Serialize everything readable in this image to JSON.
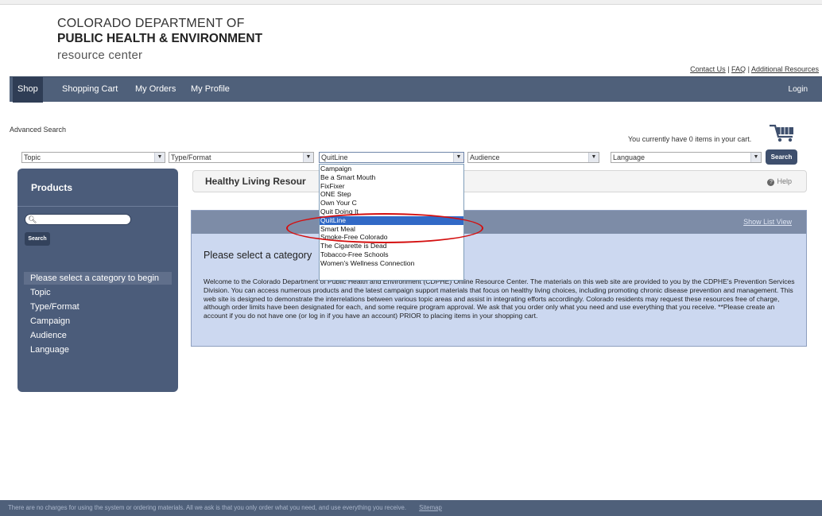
{
  "brand": {
    "line1": "COLORADO DEPARTMENT OF",
    "line2": "PUBLIC HEALTH & ENVIRONMENT",
    "line3": "resource center"
  },
  "top_links": {
    "contact": "Contact Us",
    "faq": "FAQ",
    "additional": "Additional Resources",
    "separator": "|"
  },
  "nav": {
    "shop": "Shop",
    "cart": "Shopping Cart",
    "orders": "My Orders",
    "profile": "My Profile",
    "login": "Login"
  },
  "advanced_search": "Advanced Search",
  "cart_message": "You currently have 0 items in your cart.",
  "filters": {
    "topic": "Topic",
    "type_format": "Type/Format",
    "campaign_value": "QuitLine",
    "audience": "Audience",
    "language": "Language",
    "search_button": "Search"
  },
  "campaign_options": [
    "Campaign",
    "Be a Smart Mouth",
    "FixFixer",
    "ONE Step",
    "Own Your C",
    "Quit Doing It",
    "QuitLine",
    "Smart Meal",
    "Smoke-Free Colorado",
    "The Cigarette is Dead",
    "Tobacco-Free Schools",
    "Women's Wellness Connection"
  ],
  "selected_option_index": 6,
  "sidebar": {
    "title": "Products",
    "search_button": "Search",
    "category_header": "Please select a category to begin",
    "categories": [
      "Topic",
      "Type/Format",
      "Campaign",
      "Audience",
      "Language"
    ]
  },
  "main": {
    "title": "Healthy Living Resour",
    "help": "Help",
    "show_list_view": "Show List View",
    "prompt": "Please select a category",
    "description": "Welcome to the Colorado Department of Public Health and Environment (CDPHE) Online Resource Center. The materials on this web site are provided to you by the CDPHE's Prevention Services Division. You can access numerous products and the latest campaign support materials that focus on healthy living choices, including promoting chronic disease prevention and management. This web site is designed to demonstrate the interrelations between various topic areas and assist in integrating efforts accordingly. Colorado residents may request these resources free of charge, although order limits have been designated for each, and some require program approval. We ask that you order only what you need and use everything that you receive. **Please create an account if you do not have one (or log in if you have an account) PRIOR to placing items in your shopping cart."
  },
  "footer": {
    "text": "There are no charges for using the system or ordering materials. All we ask is that you only order what you need, and use everything you receive.",
    "sitemap": "Sitemap"
  },
  "colors": {
    "nav_bg": "#4f607a",
    "panel_bg": "#4b5c7a",
    "content_bg": "#ccd8f0",
    "highlight": "#3169c6",
    "annotation_red": "#d40f0f"
  }
}
